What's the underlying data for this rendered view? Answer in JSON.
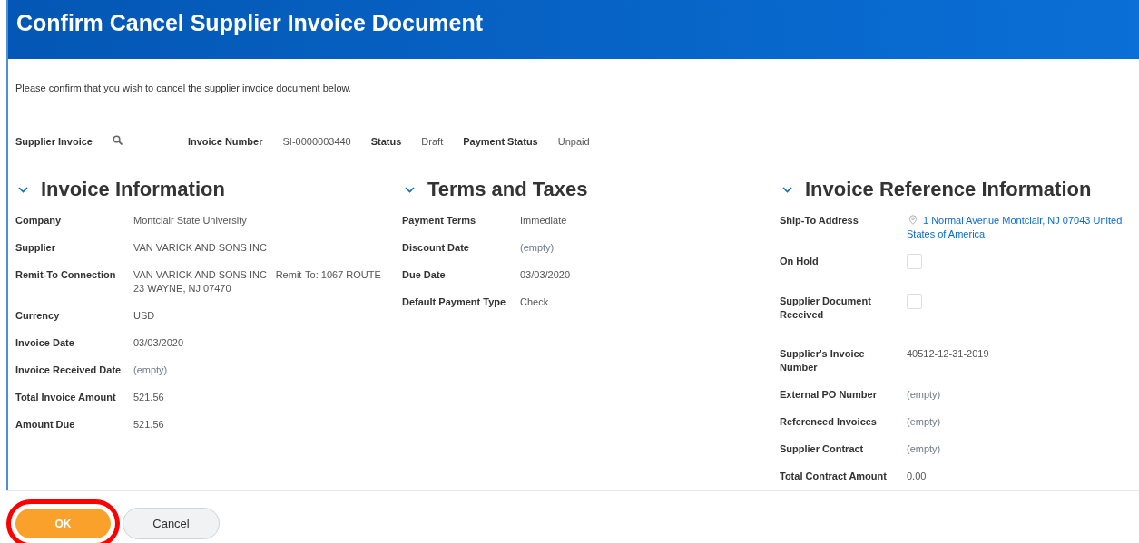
{
  "title": "Confirm Cancel Supplier Invoice Document",
  "intro": "Please confirm that you wish to cancel the supplier invoice document below.",
  "summary": [
    {
      "label": "Supplier Invoice",
      "kind": "search"
    },
    {
      "label": "Invoice Number",
      "value": "SI-0000003440",
      "kind": "text"
    },
    {
      "label": "Status",
      "value": "Draft",
      "kind": "text"
    },
    {
      "label": "Payment Status",
      "value": "Unpaid",
      "kind": "text"
    }
  ],
  "sections": [
    {
      "title": "Invoice Information",
      "expanded": true,
      "fields": [
        {
          "label": "Company",
          "value": "Montclair State University",
          "kind": "text"
        },
        {
          "label": "Supplier",
          "value": "VAN VARICK AND SONS INC",
          "kind": "text"
        },
        {
          "label": "Remit-To Connection",
          "value": "VAN VARICK AND SONS INC - Remit-To: 1067 ROUTE 23 WAYNE, NJ 07470",
          "kind": "text"
        },
        {
          "label": "Currency",
          "value": "USD",
          "kind": "text"
        },
        {
          "label": "Invoice Date",
          "value": "03/03/2020",
          "kind": "text"
        },
        {
          "label": "Invoice Received Date",
          "value": "(empty)",
          "kind": "empty"
        },
        {
          "label": "Total Invoice Amount",
          "value": "521.56",
          "kind": "text"
        },
        {
          "label": "Amount Due",
          "value": "521.56",
          "kind": "text"
        }
      ]
    },
    {
      "title": "Terms and Taxes",
      "expanded": true,
      "fields": [
        {
          "label": "Payment Terms",
          "value": "Immediate",
          "kind": "text"
        },
        {
          "label": "Discount Date",
          "value": "(empty)",
          "kind": "empty"
        },
        {
          "label": "Due Date",
          "value": "03/03/2020",
          "kind": "text"
        },
        {
          "label": "Default Payment Type",
          "value": "Check",
          "kind": "text"
        }
      ]
    },
    {
      "title": "Invoice Reference Information",
      "expanded": true,
      "fields": [
        {
          "label": "Ship-To Address",
          "value": "1 Normal Avenue Montclair, NJ 07043 United States of America",
          "kind": "link"
        },
        {
          "label": "On Hold",
          "kind": "checkbox",
          "checked": false
        },
        {
          "label": "Supplier Document Received",
          "kind": "checkbox",
          "checked": false
        },
        {
          "label": "Supplier's Invoice Number",
          "value": "40512-12-31-2019",
          "kind": "text"
        },
        {
          "label": "External PO Number",
          "value": "(empty)",
          "kind": "empty"
        },
        {
          "label": "Referenced Invoices",
          "value": "(empty)",
          "kind": "empty"
        },
        {
          "label": "Supplier Contract",
          "value": "(empty)",
          "kind": "empty"
        },
        {
          "label": "Total Contract Amount",
          "value": "0.00",
          "kind": "text"
        }
      ]
    }
  ],
  "buttons": [
    {
      "label": "OK",
      "kind": "primary",
      "highlighted": true
    },
    {
      "label": "Cancel",
      "kind": "secondary",
      "highlighted": false
    }
  ]
}
